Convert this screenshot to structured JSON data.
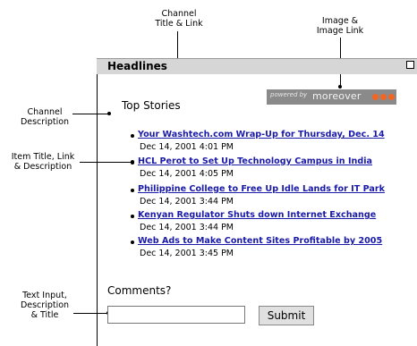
{
  "callouts": {
    "channel_title": [
      "Channel",
      "Title & Link"
    ],
    "image": [
      "Image &",
      "Image Link"
    ],
    "channel_description": [
      "Channel",
      "Description"
    ],
    "item": [
      "Item Title, Link",
      "& Description"
    ],
    "text_input": [
      "Text Input,",
      "Description",
      "& Title"
    ]
  },
  "panel": {
    "title": "Headlines",
    "channel_description": "Top Stories",
    "powered_by": "powered by",
    "brand": "moreover"
  },
  "items": [
    {
      "title": "Your Washtech.com Wrap-Up for Thursday, Dec. 14",
      "date": "Dec 14, 2001 4:01 PM"
    },
    {
      "title": "HCL Perot to Set Up Technology Campus in India",
      "date": "Dec 14, 2001 4:05 PM"
    },
    {
      "title": "Philippine College to Free Up Idle Lands for IT Park",
      "date": "Dec 14, 2001 3:44 PM"
    },
    {
      "title": "Kenyan Regulator Shuts down Internet Exchange",
      "date": "Dec 14, 2001 3:44 PM"
    },
    {
      "title": "Web Ads to Make Content Sites Profitable by 2005",
      "date": "Dec 14, 2001 3:45 PM"
    }
  ],
  "form": {
    "label": "Comments?",
    "input_value": "",
    "submit_label": "Submit"
  },
  "colors": {
    "link": "#1a1aa8",
    "titlebar": "#d6d6d6",
    "badge": "#8a8a8a",
    "badge_dots": "#f26522"
  }
}
